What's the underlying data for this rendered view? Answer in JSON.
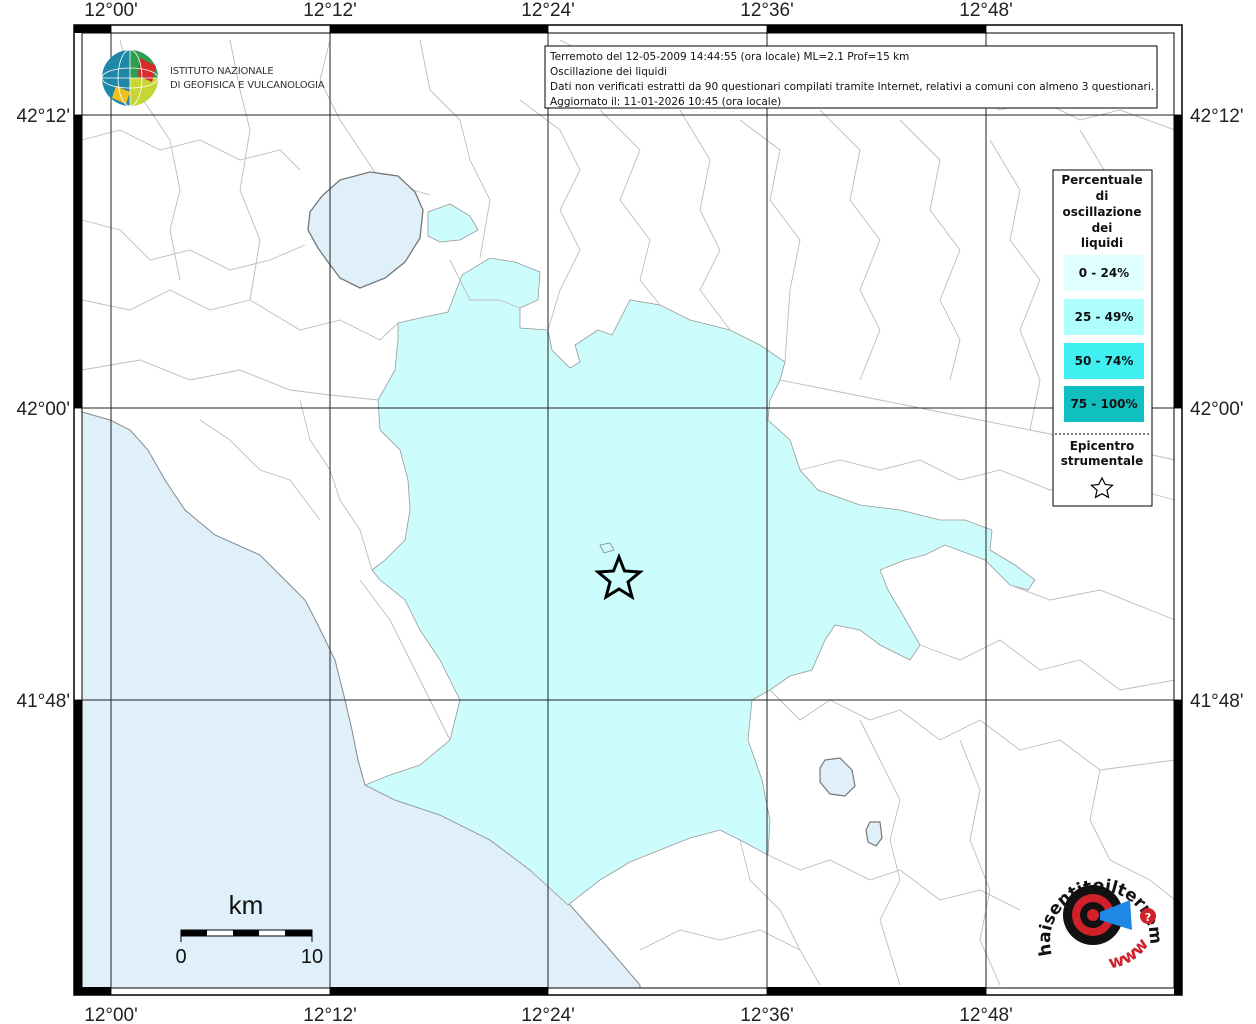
{
  "header": {
    "line1": "Terremoto del 12-05-2009 14:44:55 (ora locale) ML=2.1 Prof=15 km",
    "line2": "Oscillazione dei liquidi",
    "line3": "Dati non verificati estratti da 90 questionari compilati tramite Internet, relativi a comuni con almeno 3 questionari.",
    "line4": "Aggiornato il: 11-01-2026 10:45 (ora locale)"
  },
  "institute": {
    "line1": "ISTITUTO NAZIONALE",
    "line2": "DI GEOFISICA E VULCANOLOGIA"
  },
  "axes": {
    "lon_labels": [
      "12°00'",
      "12°12'",
      "12°24'",
      "12°36'",
      "12°48'"
    ],
    "lat_labels": [
      "42°12'",
      "42°00'",
      "41°48'"
    ]
  },
  "legend": {
    "title_lines": [
      "Percentuale",
      "di",
      "oscillazione",
      "dei",
      "liquidi"
    ],
    "classes": [
      {
        "label": "0 - 24%",
        "color": "#e0ffff"
      },
      {
        "label": "25 - 49%",
        "color": "#b0ffff"
      },
      {
        "label": "50 - 74%",
        "color": "#40f0f0"
      },
      {
        "label": "75 - 100%",
        "color": "#10c0c0"
      }
    ],
    "epicenter_lines": [
      "Epicentro",
      "strumentale"
    ]
  },
  "scale_bar": {
    "unit": "km",
    "min_label": "0",
    "max_label": "10"
  },
  "brand": {
    "text": "haisentitoilterremoto.it",
    "url_text": "www.",
    "colors": {
      "red": "#d0202a",
      "blue": "#1e88e5"
    }
  },
  "colors": {
    "sea": "#dff0fb",
    "lake": "#dff0fb",
    "affected_area": "#ccfcfc",
    "boundary": "#b8b8b8",
    "grid": "#222222"
  }
}
